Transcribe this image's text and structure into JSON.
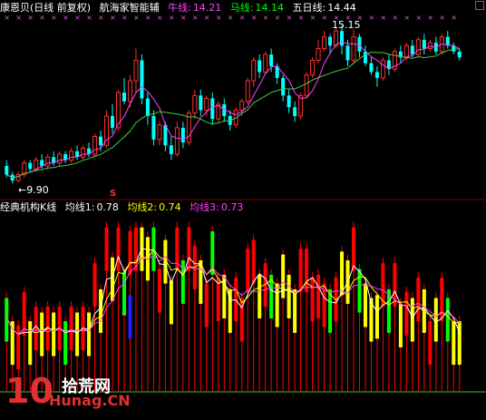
{
  "header_top": {
    "name": "康恩贝",
    "period": "(日线 前复权)",
    "indicator": "航海家智能辅",
    "ma1_label": "牛线:",
    "ma1_value": "14.21",
    "ma2_label": "马线:",
    "ma2_value": "14.14",
    "ma3_label": "五日线:",
    "ma3_value": "14.44"
  },
  "header_bottom": {
    "name": "经典机构K线",
    "l1_label": "均线1:",
    "l1_value": "0.78",
    "l2_label": "均线2:",
    "l2_value": "0.74",
    "l3_label": "均线3:",
    "l3_value": "0.73"
  },
  "annotations": {
    "high_label": "15.15",
    "low_label": "←9.90",
    "s_marker": "S"
  },
  "watermark": {
    "big": "10",
    "cn": "拾荒网",
    "url": "Hunag.CN"
  },
  "colors": {
    "header_white": "#ffffff",
    "header_yellow": "#ffff00",
    "header_green": "#00ff00",
    "header_magenta": "#ff00ff",
    "up": "#ff3030",
    "down": "#00ffff",
    "ma_magenta": "#ff40ff",
    "ma_green": "#40d040",
    "bar_red": "#ff0000",
    "bar_blue": "#2020ff",
    "bar_yellow": "#ffff00",
    "bar_green": "#00ff00",
    "baseline": "#40c040",
    "marker": "#d060d0"
  },
  "chart_data": [
    {
      "type": "candlestick",
      "title": "康恩贝 (日线 前复权)",
      "ylim": [
        9.6,
        15.6
      ],
      "labels": {
        "high": 15.15,
        "low": 9.9
      },
      "candles": [
        [
          10.5,
          10.2,
          10.7,
          10.1
        ],
        [
          10.2,
          10.0,
          10.3,
          9.9
        ],
        [
          10.0,
          10.2,
          10.3,
          9.95
        ],
        [
          10.2,
          10.6,
          10.7,
          10.1
        ],
        [
          10.6,
          10.4,
          10.7,
          10.3
        ],
        [
          10.4,
          10.7,
          10.8,
          10.3
        ],
        [
          10.7,
          10.5,
          10.9,
          10.4
        ],
        [
          10.5,
          10.8,
          10.9,
          10.4
        ],
        [
          10.8,
          10.6,
          11.0,
          10.5
        ],
        [
          10.6,
          10.9,
          11.0,
          10.5
        ],
        [
          10.9,
          10.7,
          11.0,
          10.6
        ],
        [
          10.7,
          11.0,
          11.1,
          10.6
        ],
        [
          11.0,
          10.8,
          11.2,
          10.7
        ],
        [
          10.8,
          11.1,
          11.2,
          10.7
        ],
        [
          11.1,
          10.9,
          11.3,
          10.8
        ],
        [
          10.9,
          11.5,
          11.6,
          10.8
        ],
        [
          11.5,
          11.2,
          11.7,
          11.0
        ],
        [
          11.2,
          12.2,
          12.4,
          11.1
        ],
        [
          12.2,
          11.8,
          12.6,
          11.6
        ],
        [
          11.8,
          13.0,
          13.1,
          11.7
        ],
        [
          13.0,
          12.7,
          13.5,
          12.6
        ],
        [
          12.7,
          13.4,
          13.6,
          12.5
        ],
        [
          13.4,
          14.1,
          14.5,
          13.0
        ],
        [
          14.1,
          12.8,
          14.3,
          12.6
        ],
        [
          12.8,
          12.2,
          13.0,
          11.9
        ],
        [
          12.2,
          11.4,
          12.4,
          11.2
        ],
        [
          11.4,
          11.9,
          12.0,
          11.2
        ],
        [
          11.9,
          11.2,
          12.0,
          11.0
        ],
        [
          11.2,
          10.9,
          11.5,
          10.7
        ],
        [
          10.9,
          11.8,
          12.0,
          10.8
        ],
        [
          11.8,
          11.3,
          12.0,
          11.1
        ],
        [
          11.3,
          12.3,
          12.4,
          11.2
        ],
        [
          12.3,
          12.9,
          13.1,
          12.1
        ],
        [
          12.9,
          12.4,
          13.1,
          12.2
        ],
        [
          12.4,
          12.8,
          12.9,
          12.2
        ],
        [
          12.8,
          12.1,
          13.0,
          11.9
        ],
        [
          12.1,
          12.6,
          12.7,
          12.0
        ],
        [
          12.6,
          12.2,
          12.8,
          12.0
        ],
        [
          12.2,
          11.9,
          12.4,
          11.7
        ],
        [
          11.9,
          12.4,
          12.5,
          11.8
        ],
        [
          12.4,
          12.7,
          12.8,
          12.2
        ],
        [
          12.7,
          13.4,
          13.5,
          12.6
        ],
        [
          13.4,
          14.1,
          14.2,
          13.2
        ],
        [
          14.1,
          13.7,
          14.3,
          13.5
        ],
        [
          13.7,
          14.3,
          14.4,
          13.6
        ],
        [
          14.3,
          13.9,
          14.5,
          13.7
        ],
        [
          13.9,
          13.5,
          14.0,
          13.3
        ],
        [
          13.5,
          12.9,
          13.6,
          12.7
        ],
        [
          12.9,
          12.5,
          13.1,
          12.3
        ],
        [
          12.5,
          12.2,
          12.7,
          12.0
        ],
        [
          12.2,
          12.9,
          13.0,
          12.1
        ],
        [
          12.9,
          13.6,
          13.7,
          12.8
        ],
        [
          13.6,
          14.1,
          14.2,
          13.5
        ],
        [
          14.1,
          14.5,
          14.8,
          14.0
        ],
        [
          14.5,
          14.9,
          15.1,
          14.4
        ],
        [
          14.9,
          14.6,
          15.0,
          14.3
        ],
        [
          14.6,
          15.1,
          15.2,
          14.5
        ],
        [
          15.1,
          14.6,
          15.3,
          14.3
        ],
        [
          14.6,
          14.1,
          14.8,
          13.9
        ],
        [
          14.1,
          14.9,
          15.15,
          14.0
        ],
        [
          14.9,
          14.4,
          15.0,
          14.2
        ],
        [
          14.4,
          14.0,
          14.6,
          13.9
        ],
        [
          14.0,
          13.7,
          14.2,
          13.6
        ],
        [
          13.7,
          13.5,
          13.9,
          13.2
        ],
        [
          13.5,
          14.1,
          14.2,
          13.4
        ],
        [
          14.1,
          13.8,
          14.3,
          13.6
        ],
        [
          13.8,
          14.4,
          14.5,
          13.7
        ],
        [
          14.4,
          14.2,
          14.6,
          14.0
        ],
        [
          14.2,
          14.6,
          14.7,
          14.1
        ],
        [
          14.6,
          14.3,
          14.8,
          14.2
        ],
        [
          14.3,
          14.8,
          14.9,
          14.2
        ],
        [
          14.8,
          14.5,
          15.0,
          14.3
        ],
        [
          14.5,
          14.7,
          14.8,
          14.4
        ],
        [
          14.7,
          14.4,
          14.9,
          14.3
        ],
        [
          14.4,
          14.9,
          15.0,
          14.3
        ],
        [
          14.9,
          14.6,
          15.1,
          14.5
        ],
        [
          14.6,
          14.4,
          14.7,
          14.3
        ],
        [
          14.4,
          14.2,
          14.5,
          14.1
        ]
      ]
    },
    {
      "type": "bar",
      "title": "经典机构K线",
      "ylim": [
        0,
        1.8
      ],
      "series_names": [
        "均线1",
        "均线2",
        "均线3"
      ]
    }
  ]
}
